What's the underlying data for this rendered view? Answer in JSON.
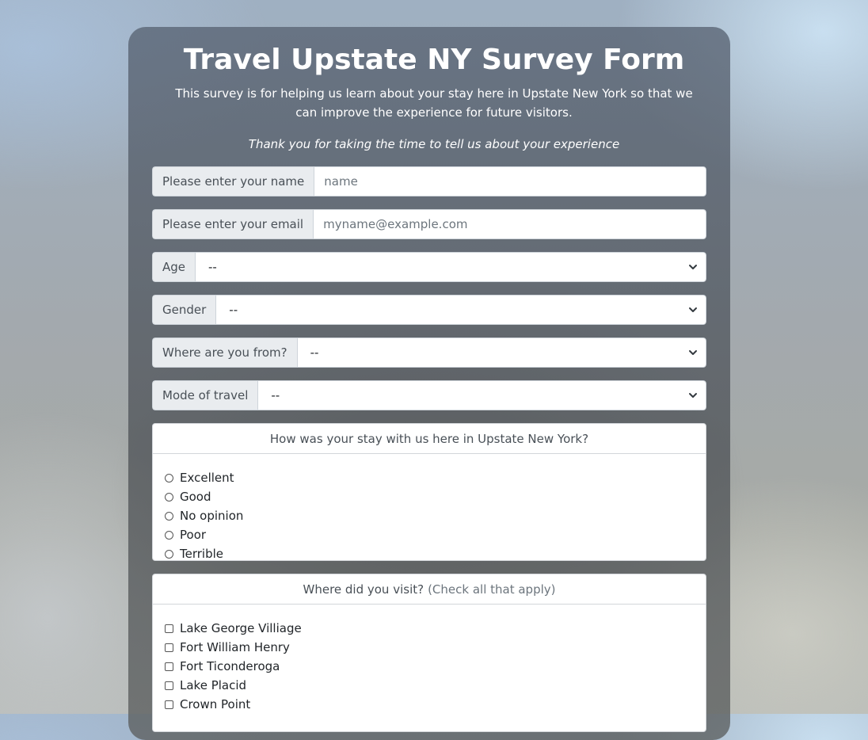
{
  "header": {
    "title": "Travel Upstate NY Survey Form",
    "description": "This survey is for helping us learn about your stay here in Upstate New York so that we can improve the experience for future visitors.",
    "thanks": "Thank you for taking the time to tell us about your experience"
  },
  "form": {
    "name": {
      "label": "Please enter your name",
      "placeholder": "name"
    },
    "email": {
      "label": "Please enter your email",
      "placeholder": "myname@example.com"
    },
    "age": {
      "label": "Age",
      "selected": "--"
    },
    "gender": {
      "label": "Gender",
      "selected": "--"
    },
    "origin": {
      "label": "Where are you from?",
      "selected": "--"
    },
    "travel_mode": {
      "label": "Mode of travel",
      "selected": "--"
    }
  },
  "stay": {
    "question": "How was your stay with us here in Upstate New York?",
    "options": [
      "Excellent",
      "Good",
      "No opinion",
      "Poor",
      "Terrible"
    ]
  },
  "visited": {
    "question": "Where did you visit?",
    "hint": "(Check all that apply)",
    "options": [
      "Lake George Villiage",
      "Fort William Henry",
      "Fort Ticonderoga",
      "Lake Placid",
      "Crown Point"
    ]
  }
}
